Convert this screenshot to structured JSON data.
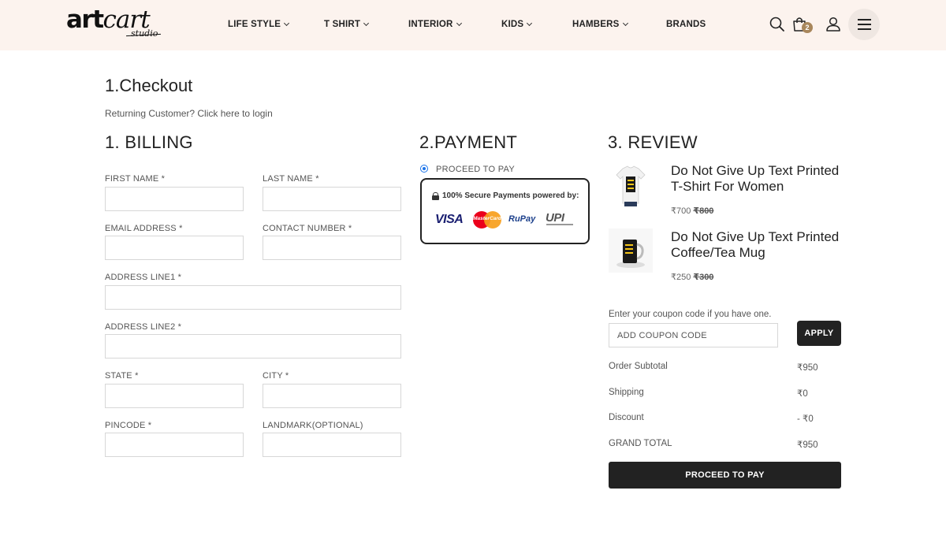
{
  "brand": {
    "logo_main": "art",
    "logo_cart": "cart",
    "logo_sub": "studio"
  },
  "nav": {
    "items": [
      {
        "label": "LIFE STYLE",
        "has_dropdown": true
      },
      {
        "label": "T SHIRT",
        "has_dropdown": true
      },
      {
        "label": "INTERIOR",
        "has_dropdown": true
      },
      {
        "label": "KIDS",
        "has_dropdown": true
      },
      {
        "label": "HAMBERS",
        "has_dropdown": true
      },
      {
        "label": "BRANDS",
        "has_dropdown": false
      }
    ]
  },
  "header_icons": {
    "search": "search-icon",
    "cart": "shopping-bag-icon",
    "cart_count": "2",
    "account": "user-icon",
    "menu": "hamburger-menu-icon"
  },
  "page": {
    "title": "1.Checkout",
    "login_prompt": "Returning Customer? Click here to login"
  },
  "billing": {
    "title": "1. BILLING",
    "fields": {
      "first_name": "FIRST NAME *",
      "last_name": "LAST NAME *",
      "email": "EMAIL ADDRESS *",
      "contact": "CONTACT NUMBER *",
      "address1": "ADDRESS LINE1 *",
      "address2": "ADDRESS LINE2 *",
      "state": "STATE *",
      "city": "CITY *",
      "pincode": "PINCODE *",
      "landmark": "LANDMARK(OPTIONAL)"
    }
  },
  "payment": {
    "title": "2.PAYMENT",
    "option_label": "PROCEED TO PAY",
    "secure_text": "100% Secure Payments powered by:",
    "logos": {
      "visa": "VISA",
      "mastercard": "MasterCard",
      "rupay_ru": "RuPay",
      "rupay_pay": "",
      "upi": "UPI"
    }
  },
  "review": {
    "title": "3. REVIEW",
    "products": [
      {
        "title": "Do Not Give Up Text Printed T-Shirt For Women",
        "price": "₹700",
        "original_price": "₹800",
        "thumb": "tshirt-image"
      },
      {
        "title": "Do Not Give Up Text Printed Coffee/Tea Mug",
        "price": "₹250",
        "original_price": "₹300",
        "thumb": "mug-image"
      }
    ],
    "coupon": {
      "hint": "Enter your coupon code if you have one.",
      "placeholder": "ADD COUPON CODE",
      "apply_label": "APPLY"
    },
    "summary": [
      {
        "label": "Order Subtotal",
        "value": "₹950"
      },
      {
        "label": "Shipping",
        "value": "₹0"
      },
      {
        "label": "Discount",
        "value": "- ₹0"
      },
      {
        "label": "GRAND TOTAL",
        "value": "₹950"
      }
    ],
    "checkout_label": "PROCEED TO PAY"
  },
  "colors": {
    "header_bg": "#fcf3ee",
    "accent_dark": "#222222",
    "badge": "#a8865b",
    "radio": "#1a73e8"
  }
}
